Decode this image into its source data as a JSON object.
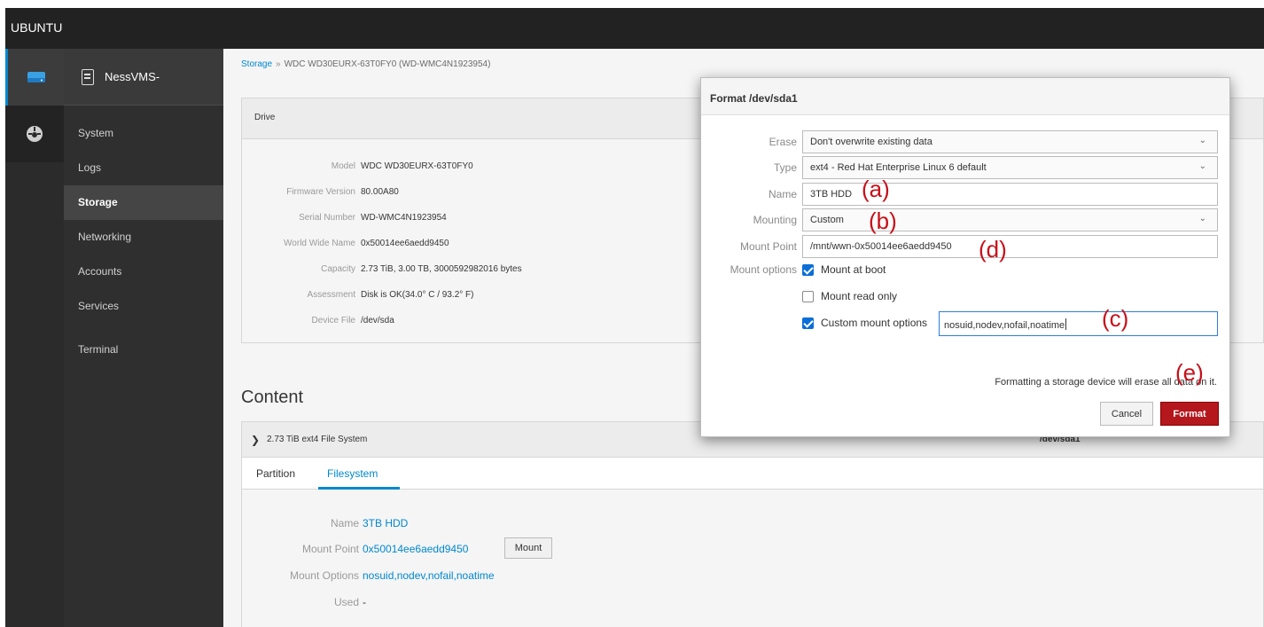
{
  "topbar": {
    "brand": "UBUNTU"
  },
  "rail": {
    "items": [
      {
        "icon": "hard-drive-icon",
        "active": true
      },
      {
        "icon": "dashboard-icon",
        "active": false
      }
    ]
  },
  "sidebar": {
    "host": "NessVMS-",
    "items": [
      {
        "label": "System"
      },
      {
        "label": "Logs"
      },
      {
        "label": "Storage",
        "active": true
      },
      {
        "label": "Networking"
      },
      {
        "label": "Accounts"
      },
      {
        "label": "Services"
      },
      {
        "label": "Terminal"
      }
    ]
  },
  "breadcrumb": {
    "root": "Storage",
    "separator": "»",
    "current": "WDC WD30EURX-63T0FY0 (WD-WMC4N1923954)"
  },
  "drive": {
    "heading": "Drive",
    "rows": [
      {
        "key": "Model",
        "value": "WDC WD30EURX-63T0FY0"
      },
      {
        "key": "Firmware Version",
        "value": "80.00A80"
      },
      {
        "key": "Serial Number",
        "value": "WD-WMC4N1923954"
      },
      {
        "key": "World Wide Name",
        "value": "0x50014ee6aedd9450"
      },
      {
        "key": "Capacity",
        "value": "2.73 TiB, 3.00 TB, 3000592982016 bytes"
      },
      {
        "key": "Assessment",
        "value": "Disk is OK(34.0° C / 93.2° F)"
      },
      {
        "key": "Device File",
        "value": "/dev/sda"
      }
    ]
  },
  "content": {
    "title": "Content",
    "fs_label": "2.73 TiB ext4 File System",
    "fs_device": "/dev/sda1",
    "tabs": [
      {
        "label": "Partition"
      },
      {
        "label": "Filesystem",
        "active": true
      }
    ],
    "fs": {
      "name_key": "Name",
      "name_value": "3TB HDD",
      "mount_key": "Mount Point",
      "mount_value": "0x50014ee6aedd9450",
      "mount_button": "Mount",
      "options_key": "Mount Options",
      "options_value": "nosuid,nodev,nofail,noatime",
      "used_key": "Used",
      "used_value": "-"
    }
  },
  "dialog": {
    "title": "Format /dev/sda1",
    "erase_label": "Erase",
    "erase_value": "Don't overwrite existing data",
    "type_label": "Type",
    "type_value": "ext4 - Red Hat Enterprise Linux 6 default",
    "name_label": "Name",
    "name_value": "3TB HDD",
    "mounting_label": "Mounting",
    "mounting_value": "Custom",
    "mountpoint_label": "Mount Point",
    "mountpoint_value": "/mnt/wwn-0x50014ee6aedd9450",
    "options_label": "Mount options",
    "mount_at_boot": {
      "label": "Mount at boot",
      "checked": true
    },
    "mount_read_only": {
      "label": "Mount read only",
      "checked": false
    },
    "custom_options": {
      "label": "Custom mount options",
      "checked": true,
      "value": "nosuid,nodev,nofail,noatime"
    },
    "warning": "Formatting a storage device will erase all data on it.",
    "cancel": "Cancel",
    "format": "Format"
  },
  "annotations": {
    "a": "(a)",
    "b": "(b)",
    "c": "(c)",
    "d": "(d)",
    "e": "(e)",
    "color": "#c8101a"
  }
}
